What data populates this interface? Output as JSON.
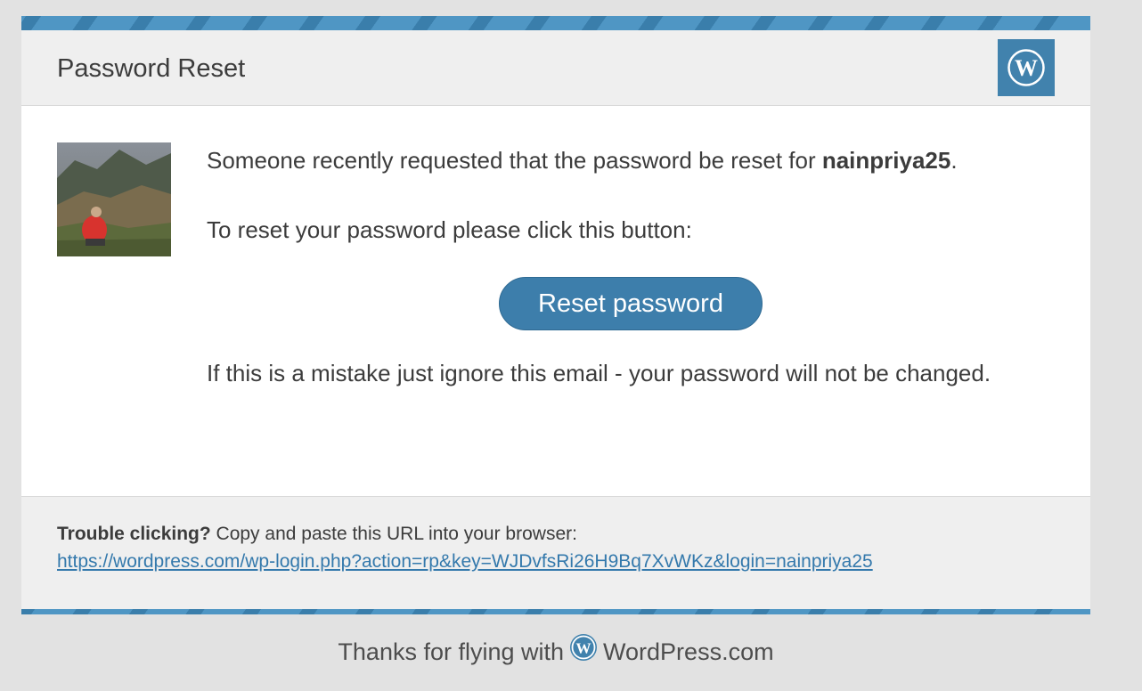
{
  "header": {
    "title": "Password Reset",
    "logo_icon": "wordpress-logo-icon"
  },
  "avatar": {
    "icon": "user-avatar-photo"
  },
  "message": {
    "line1_prefix": "Someone recently requested that the password be reset for ",
    "username": "nainpriya25",
    "line1_suffix": ".",
    "line2": "To reset your password please click this button:",
    "line3": "If this is a mistake just ignore this email - your password will not be changed."
  },
  "button": {
    "label": "Reset password"
  },
  "footer_box": {
    "trouble_bold": "Trouble clicking?",
    "trouble_text": " Copy and paste this URL into your browser:",
    "url": "https://wordpress.com/wp-login.php?action=rp&key=WJDvfsRi26H9Bq7XvWKz&login=nainpriya25"
  },
  "thanks": {
    "prefix": "Thanks for flying with",
    "brand": "WordPress.com"
  },
  "colors": {
    "accent": "#4182ad",
    "stripe": "#4f96c4",
    "button": "#3d7eab",
    "link": "#3479ac",
    "panel": "#efefef",
    "page_background": "#e2e2e2"
  }
}
